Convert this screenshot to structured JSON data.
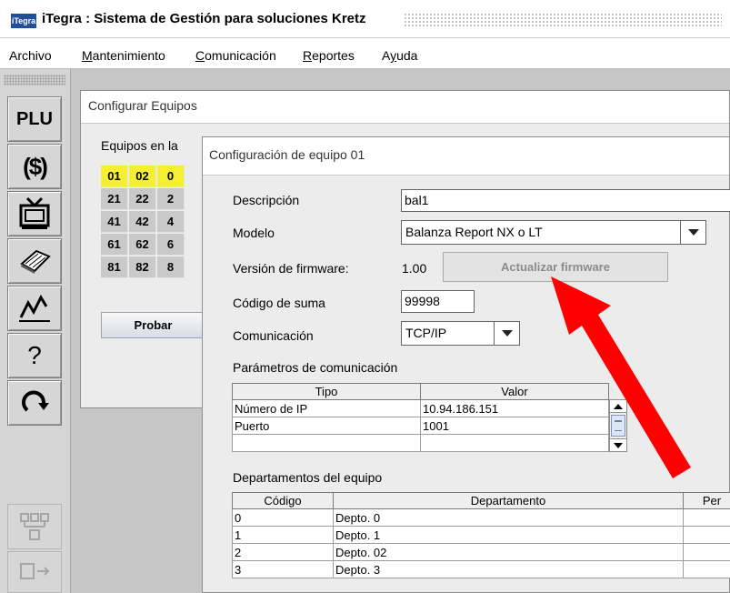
{
  "app": {
    "logo_text": "iTegra",
    "title": "iTegra : Sistema de Gestión para soluciones Kretz"
  },
  "menu": [
    {
      "label": "Archivo",
      "mnemonic": ""
    },
    {
      "label": "Mantenimiento",
      "mnemonic": "M"
    },
    {
      "label": "Comunicación",
      "mnemonic": "C"
    },
    {
      "label": "Reportes",
      "mnemonic": "R"
    },
    {
      "label": "Ayuda",
      "mnemonic": "y"
    }
  ],
  "toolbar": {
    "plu_label": "PLU",
    "prices_label": "($)",
    "help_label": "?"
  },
  "equipos_window": {
    "title": "Configurar Equipos",
    "list_label": "Equipos en la",
    "rows": [
      [
        "01",
        "02",
        "0"
      ],
      [
        "21",
        "22",
        "2"
      ],
      [
        "41",
        "42",
        "4"
      ],
      [
        "61",
        "62",
        "6"
      ],
      [
        "81",
        "82",
        "8"
      ]
    ],
    "selected": [
      "01",
      "02",
      "0"
    ],
    "probar_label": "Probar"
  },
  "equipo_dialog": {
    "title": "Configuración de equipo 01",
    "descripcion_label": "Descripción",
    "descripcion_value": "bal1",
    "modelo_label": "Modelo",
    "modelo_value": "Balanza Report NX o LT",
    "firmware_label": "Versión de firmware:",
    "firmware_value": "1.00",
    "firmware_button": "Actualizar firmware",
    "suma_label": "Código de suma",
    "suma_value": "99998",
    "comunicacion_label": "Comunicación",
    "comunicacion_value": "TCP/IP",
    "params_label": "Parámetros de comunicación",
    "params_headers": [
      "Tipo",
      "Valor"
    ],
    "params_rows": [
      [
        "Número de IP",
        "10.94.186.151"
      ],
      [
        "Puerto",
        "1001"
      ],
      [
        "",
        ""
      ]
    ],
    "deptos_label": "Departamentos del equipo",
    "deptos_headers": [
      "Código",
      "Departamento",
      "Per"
    ],
    "deptos_rows": [
      [
        "0",
        "Depto. 0",
        ""
      ],
      [
        "1",
        "Depto. 1",
        ""
      ],
      [
        "2",
        "Depto. 02",
        ""
      ],
      [
        "3",
        "Depto. 3",
        ""
      ]
    ]
  },
  "colors": {
    "selected_cell": "#f5ef33",
    "annotation_arrow": "#ff0000"
  }
}
